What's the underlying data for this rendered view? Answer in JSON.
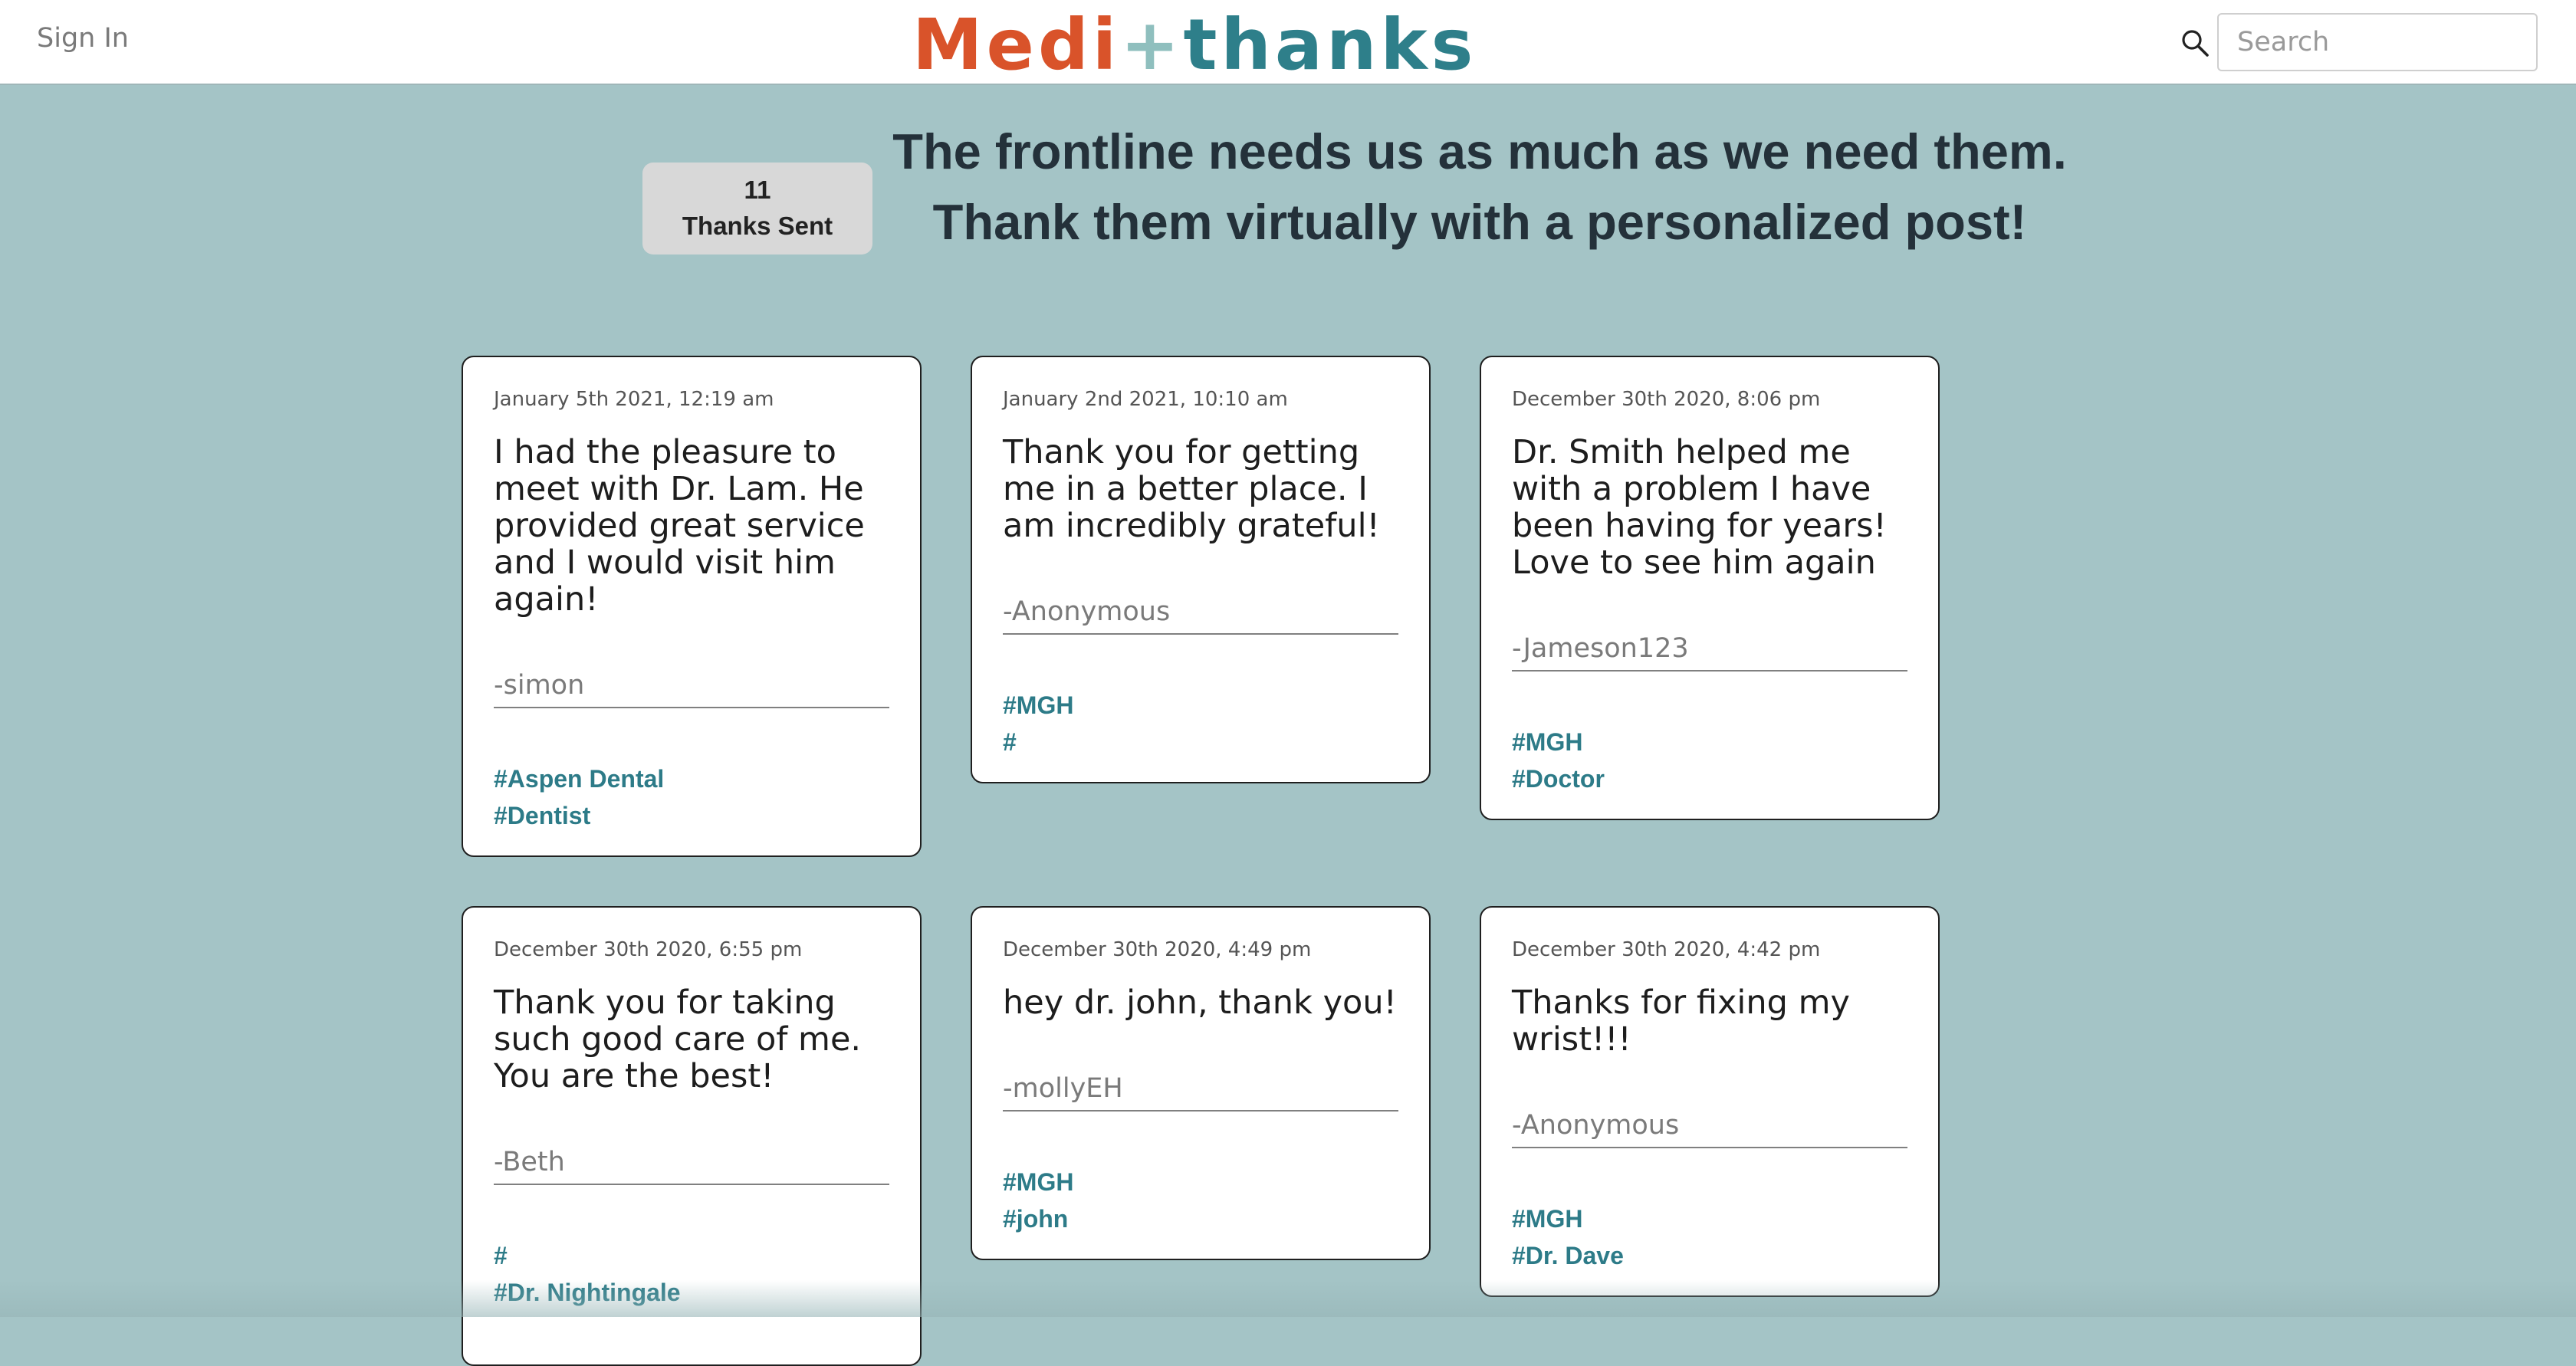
{
  "header": {
    "signin_label": "Sign In",
    "logo": {
      "part1": "Medi",
      "part2": "+",
      "part3": "thanks"
    },
    "search_placeholder": "Search",
    "search_value": ""
  },
  "counter": {
    "count": "11",
    "label": "Thanks Sent"
  },
  "tagline": {
    "line1": "The frontline needs us as much as we need them.",
    "line2": "Thank them virtually with a personalized post!"
  },
  "cards": [
    {
      "date": "January 5th 2021, 12:19 am",
      "message": "I had the pleasure to meet with Dr. Lam. He provided great service and I would visit him again!",
      "author": "-simon",
      "tags": [
        "#Aspen Dental",
        "#Dentist"
      ]
    },
    {
      "date": "January 2nd 2021, 10:10 am",
      "message": "Thank you for getting me in a better place. I am incredibly grateful!",
      "author": "-Anonymous",
      "tags": [
        "#MGH",
        "#"
      ]
    },
    {
      "date": "December 30th 2020, 8:06 pm",
      "message": "Dr. Smith helped me with a problem I have been having for years! Love to see him again",
      "author": "-Jameson123",
      "tags": [
        "#MGH",
        "#Doctor"
      ]
    },
    {
      "date": "December 30th 2020, 6:55 pm",
      "message": "Thank you for taking such good care of me. You are the best!",
      "author": "-Beth",
      "tags": [
        "#",
        "#Dr. Nightingale"
      ]
    },
    {
      "date": "December 30th 2020, 4:49 pm",
      "message": "hey dr. john, thank you!",
      "author": "-mollyEH",
      "tags": [
        "#MGH",
        "#john"
      ]
    },
    {
      "date": "December 30th 2020, 4:42 pm",
      "message": "Thanks for fixing my wrist!!!",
      "author": "-Anonymous",
      "tags": [
        "#MGH",
        "#Dr. Dave"
      ]
    }
  ]
}
